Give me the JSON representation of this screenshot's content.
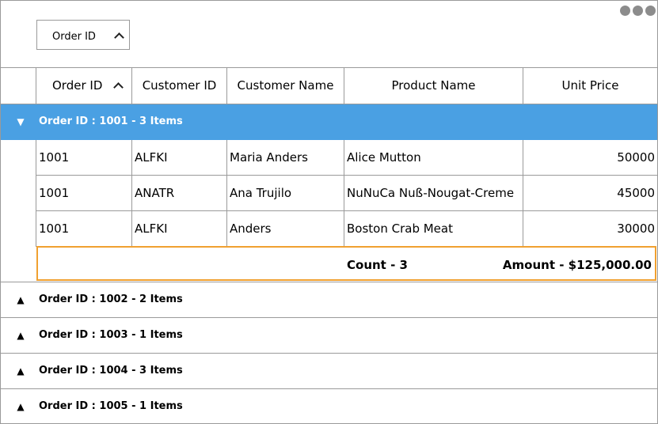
{
  "grouping": {
    "chip_label": "Order ID"
  },
  "columns": [
    "Order ID",
    "Customer ID",
    "Customer Name",
    "Product Name",
    "Unit Price"
  ],
  "groups": [
    {
      "label": "Order ID : 1001 - 3 Items",
      "expanded": true,
      "rows": [
        [
          "1001",
          "ALFKI",
          "Maria Anders",
          "Alice Mutton",
          "50000"
        ],
        [
          "1001",
          "ANATR",
          "Ana Trujilo",
          "NuNuCa Nuß-Nougat-Creme",
          "45000"
        ],
        [
          "1001",
          "ALFKI",
          "Anders",
          "Boston Crab Meat",
          "30000"
        ]
      ],
      "summary": {
        "count": "Count - 3",
        "amount": "Amount - $125,000.00"
      }
    },
    {
      "label": "Order ID : 1002 - 2 Items",
      "expanded": false
    },
    {
      "label": "Order ID : 1003 - 1 Items",
      "expanded": false
    },
    {
      "label": "Order ID : 1004 - 3 Items",
      "expanded": false
    },
    {
      "label": "Order ID : 1005 - 1 Items",
      "expanded": false
    }
  ],
  "icons": {
    "expanded_toggle": "▼",
    "collapsed_toggle": "▲",
    "more": "more-dots-icon"
  },
  "colors": {
    "group_selected_bg": "#4aa0e3",
    "summary_border": "#f0a030"
  }
}
